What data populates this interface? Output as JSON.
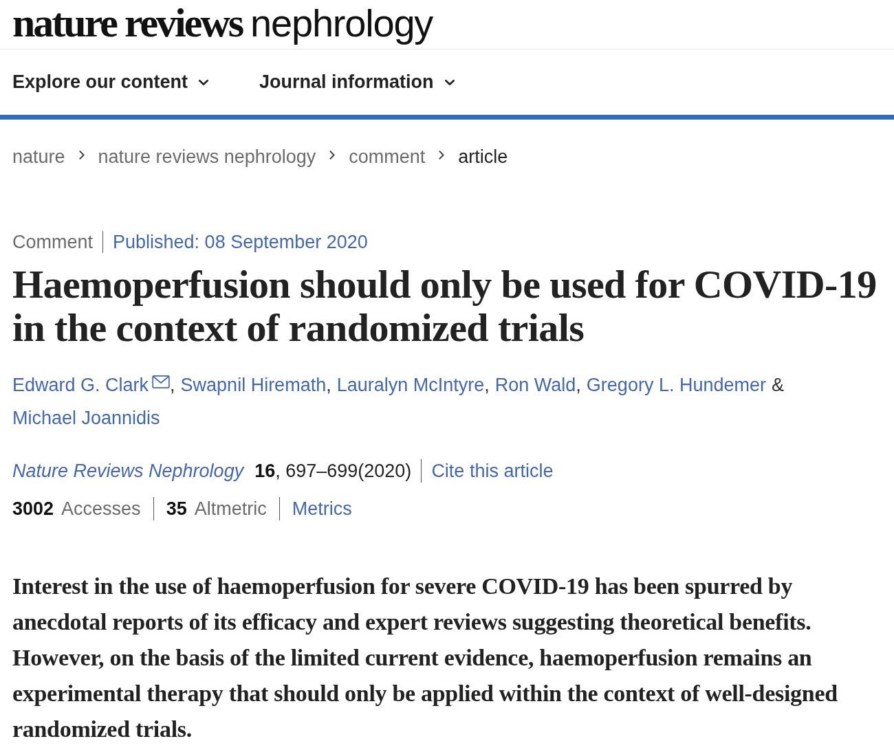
{
  "header": {
    "logo": {
      "bold": "nature reviews",
      "light": "nephrology"
    }
  },
  "nav": [
    {
      "label": "Explore our content"
    },
    {
      "label": "Journal information"
    }
  ],
  "breadcrumbs": [
    {
      "label": "nature",
      "current": false
    },
    {
      "label": "nature reviews nephrology",
      "current": false
    },
    {
      "label": "comment",
      "current": false
    },
    {
      "label": "article",
      "current": true
    }
  ],
  "article": {
    "type": "Comment",
    "published": "Published: 08 September 2020",
    "title": "Haemoperfusion should only be used for COVID-19 in the context of randomized trials",
    "authors": [
      {
        "name": "Edward G. Clark",
        "email": true,
        "separator": ","
      },
      {
        "name": "Swapnil Hiremath",
        "email": false,
        "separator": ","
      },
      {
        "name": "Lauralyn McIntyre",
        "email": false,
        "separator": ","
      },
      {
        "name": "Ron Wald",
        "email": false,
        "separator": ","
      },
      {
        "name": "Gregory L. Hundemer",
        "email": false,
        "conjunction": "&"
      },
      {
        "name": "Michael Joannidis",
        "email": false
      }
    ],
    "citation": {
      "journal": "Nature Reviews Nephrology",
      "volume": "16",
      "pages": ", 697–699(2020)",
      "cite_link": "Cite this article"
    },
    "metrics": [
      {
        "count": "3002",
        "label": "Accesses"
      },
      {
        "count": "35",
        "label": "Altmetric"
      }
    ],
    "metrics_link": "Metrics",
    "abstract": "Interest in the use of haemoperfusion for severe COVID-19 has been spurred by anecdotal reports of its efficacy and expert reviews suggesting theoretical benefits. However, on the basis of the limited current evidence, haemoperfusion remains an experimental therapy that should only be applied within the context of well-designed randomized trials."
  }
}
